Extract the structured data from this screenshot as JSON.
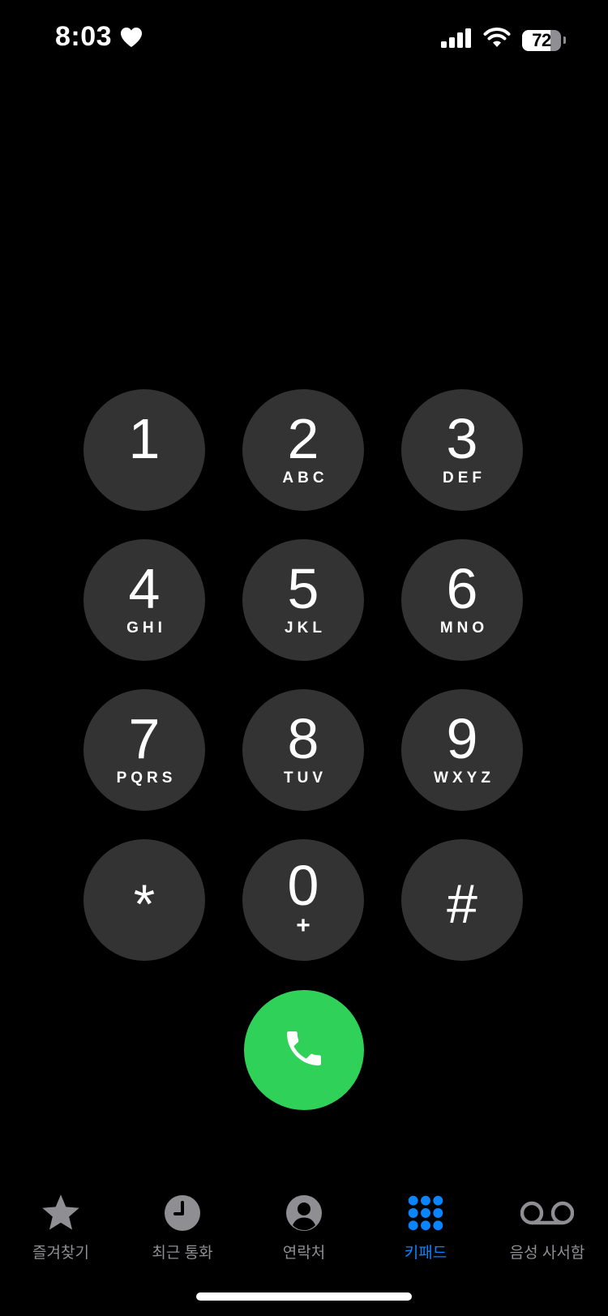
{
  "status_bar": {
    "time": "8:03",
    "battery_percent": "72",
    "battery_level": 0.72
  },
  "keypad": {
    "keys": [
      {
        "digit": "1",
        "letters": ""
      },
      {
        "digit": "2",
        "letters": "ABC"
      },
      {
        "digit": "3",
        "letters": "DEF"
      },
      {
        "digit": "4",
        "letters": "GHI"
      },
      {
        "digit": "5",
        "letters": "JKL"
      },
      {
        "digit": "6",
        "letters": "MNO"
      },
      {
        "digit": "7",
        "letters": "PQRS"
      },
      {
        "digit": "8",
        "letters": "TUV"
      },
      {
        "digit": "9",
        "letters": "WXYZ"
      },
      {
        "digit": "*",
        "letters": ""
      },
      {
        "digit": "0",
        "letters": "+"
      },
      {
        "digit": "#",
        "letters": ""
      }
    ]
  },
  "call_button": {
    "icon": "phone-icon",
    "color": "#30d158"
  },
  "tab_bar": {
    "active_color": "#0a84ff",
    "inactive_color": "#8e8e93",
    "tabs": [
      {
        "label": "즐겨찾기",
        "icon": "star-icon"
      },
      {
        "label": "최근 통화",
        "icon": "clock-icon"
      },
      {
        "label": "연락처",
        "icon": "person-icon"
      },
      {
        "label": "키패드",
        "icon": "keypad-icon",
        "active": true
      },
      {
        "label": "음성 사서함",
        "icon": "voicemail-icon"
      }
    ]
  }
}
